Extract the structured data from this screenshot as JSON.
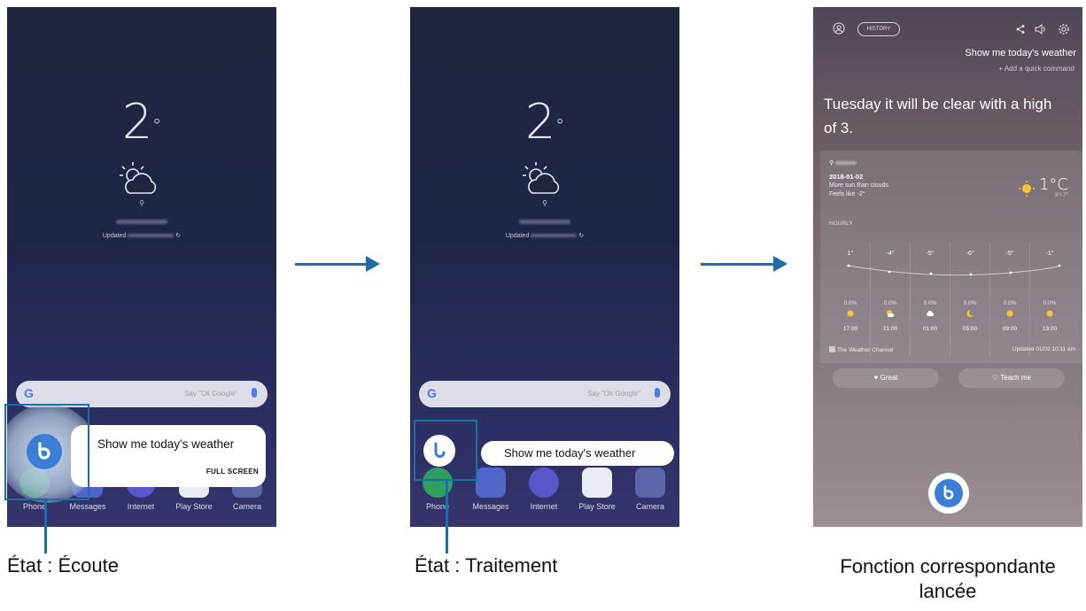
{
  "colors": {
    "accent": "#1b6ea8",
    "bixby_blue": "#3a7fd5"
  },
  "screen1": {
    "temperature": "2",
    "degree": "°",
    "updated_label": "Updated",
    "search_placeholder": "Say \"Ok Google\"",
    "search_logo": "G",
    "utterance": "Show me today's weather",
    "full_screen_label": "FULL SCREEN",
    "apps": [
      "Phone",
      "Messages",
      "Internet",
      "Play Store",
      "Camera"
    ]
  },
  "screen2": {
    "temperature": "2",
    "degree": "°",
    "updated_label": "Updated",
    "search_placeholder": "Say \"Ok Google\"",
    "search_logo": "G",
    "utterance": "Show me today's weather",
    "apps": [
      "Phone",
      "Messages",
      "Internet",
      "Play Store",
      "Camera"
    ]
  },
  "screen3": {
    "history_label": "HISTORY",
    "query": "Show me today's weather",
    "add_quick_command": "+ Add a quick command",
    "answer": "Tuesday it will be clear with a high of 3.",
    "card": {
      "date": "2018-01-02",
      "description": "More sun than clouds",
      "feels_like": "Feels like -2°",
      "current_temp": "1°C",
      "hi_lo": "3°/-7°",
      "hourly_label": "HOURLY",
      "hourly": [
        {
          "temp": "1°",
          "precip": "0.0%",
          "time": "17:00",
          "icon": "sun-icon"
        },
        {
          "temp": "-4°",
          "precip": "0.0%",
          "time": "21:00",
          "icon": "moon-cloud-icon"
        },
        {
          "temp": "-5°",
          "precip": "0.0%",
          "time": "01:00",
          "icon": "cloud-icon"
        },
        {
          "temp": "-6°",
          "precip": "0.0%",
          "time": "05:00",
          "icon": "moon-icon"
        },
        {
          "temp": "-5°",
          "precip": "0.0%",
          "time": "09:00",
          "icon": "sun-icon"
        },
        {
          "temp": "-1°",
          "precip": "0.0%",
          "time": "13:00",
          "icon": "sun-icon"
        }
      ],
      "source": "The Weather Channel",
      "updated": "Updated 01/02 10:11 am"
    },
    "great_label": "Great",
    "teach_label": "Teach me"
  },
  "captions": {
    "listening": "État : Écoute",
    "processing": "État : Traitement",
    "launched_line1": "Fonction correspondante",
    "launched_line2": "lancée"
  }
}
